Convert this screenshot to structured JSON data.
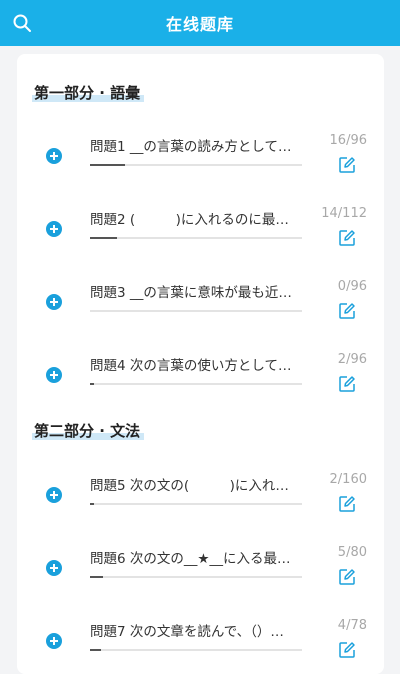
{
  "header": {
    "title": "在线题库"
  },
  "sections": [
    {
      "title": "第一部分 · 語彙"
    },
    {
      "title": "第二部分 · 文法"
    }
  ],
  "questions": [
    {
      "title": "問題1 __の言葉の読み方として…",
      "count": "16/96",
      "progress": 0.167
    },
    {
      "title": "問題2 (　　　)に入れるのに最…",
      "count": "14/112",
      "progress": 0.125
    },
    {
      "title": "問題3 __の言葉に意味が最も近…",
      "count": "0/96",
      "progress": 0
    },
    {
      "title": "問題4 次の言葉の使い方として…",
      "count": "2/96",
      "progress": 0.021
    },
    {
      "title": "問題5 次の文の(　　　)に入れ…",
      "count": "2/160",
      "progress": 0.0125
    },
    {
      "title": "問題6 次の文の__★__に入る最…",
      "count": "5/80",
      "progress": 0.0625
    },
    {
      "title": "問題7 次の文章を読んで、（）…",
      "count": "4/78",
      "progress": 0.051
    }
  ],
  "colors": {
    "header": "#1ab0e8",
    "accent": "#1aa0dc",
    "section_highlight": "#cfe8f7"
  },
  "icons": {
    "search": "search-icon",
    "add": "add-circle-icon",
    "edit": "edit-icon"
  }
}
